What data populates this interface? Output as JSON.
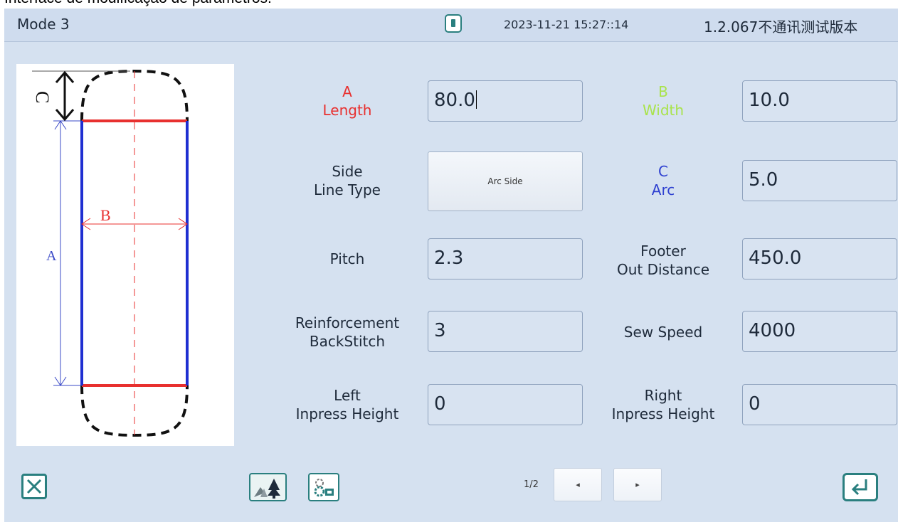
{
  "caption": "Interface de modificação de parâmetros.",
  "topbar": {
    "mode": "Mode 3",
    "datetime": "2023-11-21 15:27::14",
    "version": "1.2.067不通讯测试版本",
    "usb_icon": "usb-drive-icon"
  },
  "diagram": {
    "label_a": "A",
    "label_b": "B",
    "label_c": "C"
  },
  "params": {
    "length": {
      "line1": "A",
      "line2": "Length",
      "value": "80.0"
    },
    "width": {
      "line1": "B",
      "line2": "Width",
      "value": "10.0"
    },
    "side": {
      "line1": "Side",
      "line2": "Line Type",
      "button": "Arc Side"
    },
    "arc": {
      "line1": "C",
      "line2": "Arc",
      "value": "5.0"
    },
    "pitch": {
      "label": "Pitch",
      "value": "2.3"
    },
    "footer": {
      "line1": "Footer",
      "line2": "Out Distance",
      "value": "450.0"
    },
    "reinforcement": {
      "line1": "Reinforcement",
      "line2": "BackStitch",
      "value": "3"
    },
    "sewspeed": {
      "label": "Sew Speed",
      "value": "4000"
    },
    "left_inpress": {
      "line1": "Left",
      "line2": "Inpress Height",
      "value": "0"
    },
    "right_inpress": {
      "line1": "Right",
      "line2": "Inpress Height",
      "value": "0"
    }
  },
  "footer_bar": {
    "page": "1/2",
    "prev": "◂",
    "next": "▸"
  },
  "colors": {
    "length": "#e8302f",
    "width": "#a9e34b",
    "arc": "#2d3fd0",
    "accent": "#2a7f7f"
  }
}
